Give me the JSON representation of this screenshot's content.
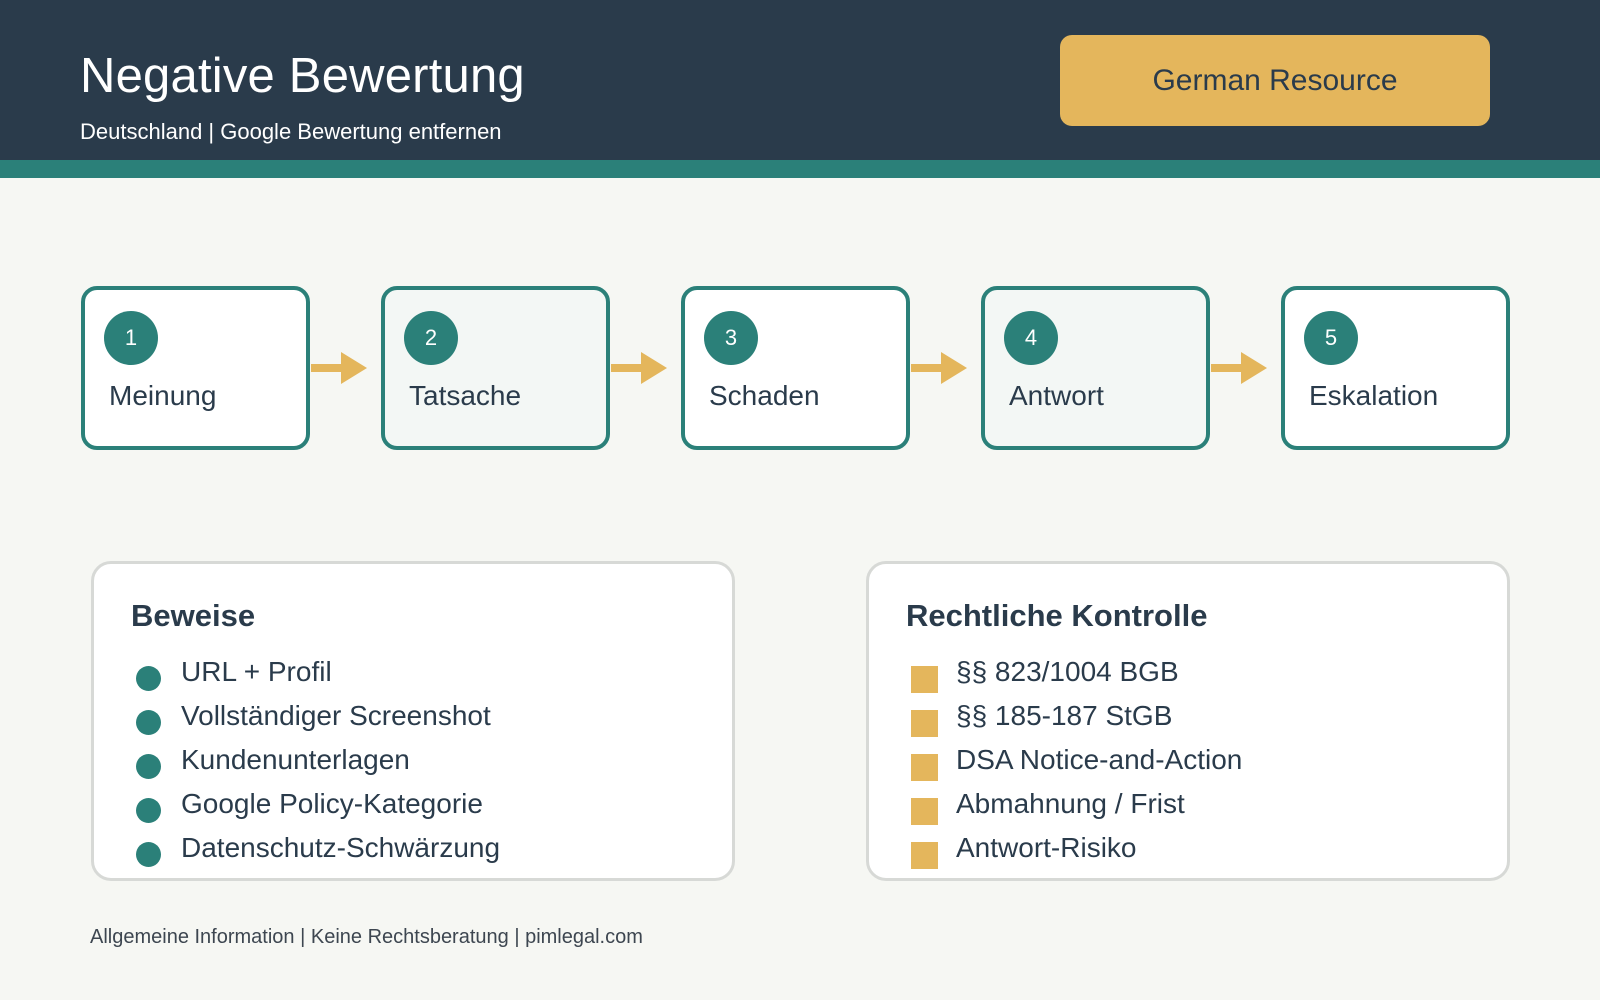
{
  "header": {
    "title": "Negative Bewertung",
    "subtitle": "Deutschland | Google Bewertung entfernen",
    "badge": "German Resource"
  },
  "flow": {
    "steps": [
      {
        "number": "1",
        "label": "Meinung"
      },
      {
        "number": "2",
        "label": "Tatsache"
      },
      {
        "number": "3",
        "label": "Schaden"
      },
      {
        "number": "4",
        "label": "Antwort"
      },
      {
        "number": "5",
        "label": "Eskalation"
      }
    ]
  },
  "evidence": {
    "title": "Beweise",
    "items": [
      "URL + Profil",
      "Vollständiger Screenshot",
      "Kundenunterlagen",
      "Google Policy-Kategorie",
      "Datenschutz-Schwärzung"
    ]
  },
  "legal": {
    "title": "Rechtliche Kontrolle",
    "items": [
      "§§ 823/1004 BGB",
      "§§ 185-187 StGB",
      "DSA Notice-and-Action",
      "Abmahnung / Frist",
      "Antwort-Risiko"
    ]
  },
  "footer": {
    "text": "Allgemeine Information | Keine Rechtsberatung | pimlegal.com"
  },
  "colors": {
    "header_bg": "#2a3b4b",
    "accent_teal": "#2b8079",
    "accent_gold": "#e4b65c",
    "page_bg": "#f6f7f3"
  }
}
